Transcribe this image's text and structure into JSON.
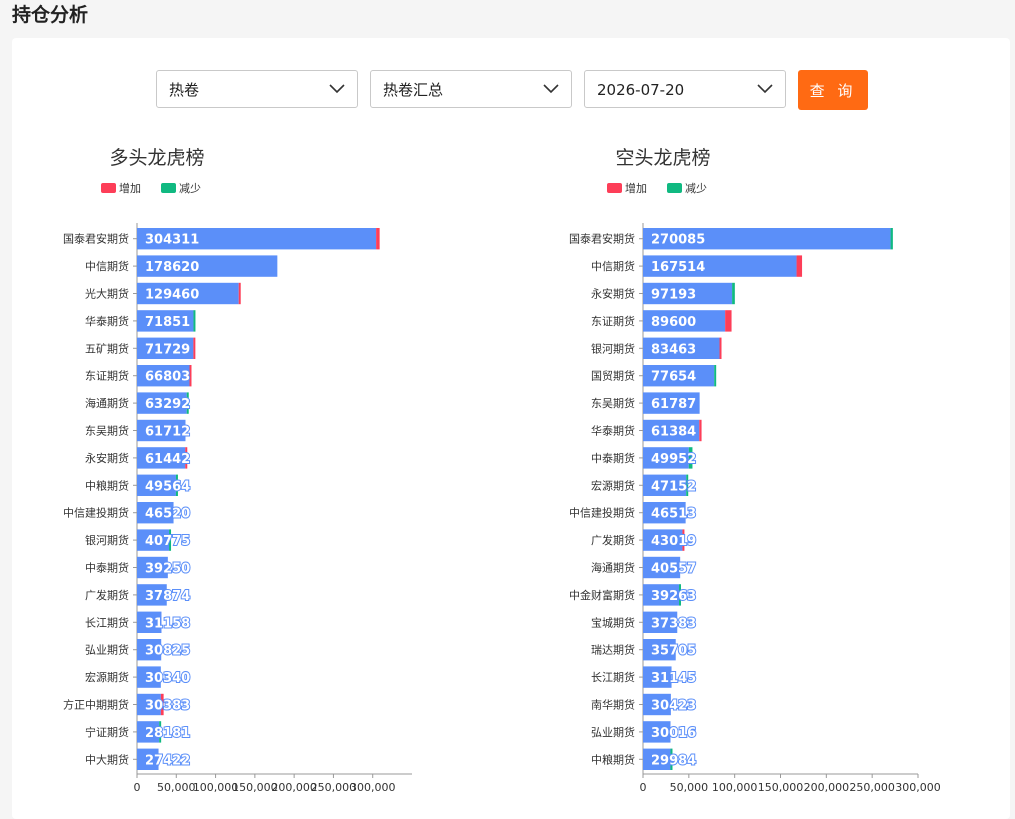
{
  "page": {
    "title": "持仓分析"
  },
  "filters": {
    "variety": "热卷",
    "contract": "热卷汇总",
    "date": "2026-07-20",
    "query_label": "查 询"
  },
  "colors": {
    "bar": "#5b8ff9",
    "increase": "#fd3e58",
    "decrease": "#10b981",
    "accent": "#ff6a13"
  },
  "chart_data": [
    {
      "type": "bar",
      "orientation": "horizontal",
      "stacked": true,
      "title": "多头龙虎榜",
      "legend": [
        "增加",
        "减少"
      ],
      "legend_position": "top-center",
      "xlim": [
        0,
        350000
      ],
      "xticks": [
        "0",
        "50,000",
        "100,000",
        "150,000",
        "200,000",
        "250,000",
        "300,000"
      ],
      "categories": [
        "国泰君安期货",
        "中信期货",
        "光大期货",
        "华泰期货",
        "五矿期货",
        "东证期货",
        "海通期货",
        "东吴期货",
        "永安期货",
        "中粮期货",
        "中信建投期货",
        "银河期货",
        "中泰期货",
        "广发期货",
        "长江期货",
        "弘业期货",
        "宏源期货",
        "方正中期期货",
        "宁证期货",
        "中大期货"
      ],
      "values": [
        304311,
        178620,
        129460,
        71851,
        71729,
        66803,
        63292,
        61712,
        61442,
        49564,
        46520,
        40775,
        39250,
        37874,
        31158,
        30825,
        30340,
        30383,
        28181,
        27422
      ],
      "series": [
        {
          "name": "增加",
          "values": [
            4500,
            0,
            1500,
            0,
            500,
            2000,
            0,
            0,
            1000,
            0,
            0,
            0,
            0,
            0,
            0,
            0,
            0,
            3500,
            0,
            0
          ]
        },
        {
          "name": "减少",
          "values": [
            0,
            0,
            0,
            1800,
            0,
            0,
            2500,
            0,
            0,
            1000,
            0,
            1500,
            0,
            0,
            0,
            0,
            0,
            0,
            1000,
            0
          ]
        }
      ]
    },
    {
      "type": "bar",
      "orientation": "horizontal",
      "stacked": true,
      "title": "空头龙虎榜",
      "legend": [
        "增加",
        "减少"
      ],
      "legend_position": "top-center",
      "xlim": [
        0,
        300000
      ],
      "xticks": [
        "0",
        "50,000",
        "100,000",
        "150,000",
        "200,000",
        "250,000",
        "300,000"
      ],
      "categories": [
        "国泰君安期货",
        "中信期货",
        "永安期货",
        "东证期货",
        "银河期货",
        "国贸期货",
        "东吴期货",
        "华泰期货",
        "中泰期货",
        "宏源期货",
        "中信建投期货",
        "广发期货",
        "海通期货",
        "中金财富期货",
        "宝城期货",
        "瑞达期货",
        "长江期货",
        "南华期货",
        "弘业期货",
        "中粮期货"
      ],
      "values": [
        270085,
        167514,
        97193,
        89600,
        83463,
        77654,
        61787,
        61384,
        49952,
        47152,
        46513,
        43019,
        40557,
        39263,
        37383,
        35705,
        31145,
        30423,
        30016,
        29984
      ],
      "series": [
        {
          "name": "增加",
          "values": [
            0,
            6000,
            0,
            7000,
            1500,
            0,
            0,
            2500,
            0,
            0,
            0,
            1000,
            0,
            0,
            0,
            0,
            0,
            0,
            0,
            0
          ]
        },
        {
          "name": "减少",
          "values": [
            2500,
            0,
            3000,
            0,
            0,
            2000,
            0,
            0,
            4000,
            1500,
            0,
            0,
            0,
            1500,
            0,
            0,
            0,
            0,
            0,
            1000
          ]
        }
      ]
    }
  ]
}
